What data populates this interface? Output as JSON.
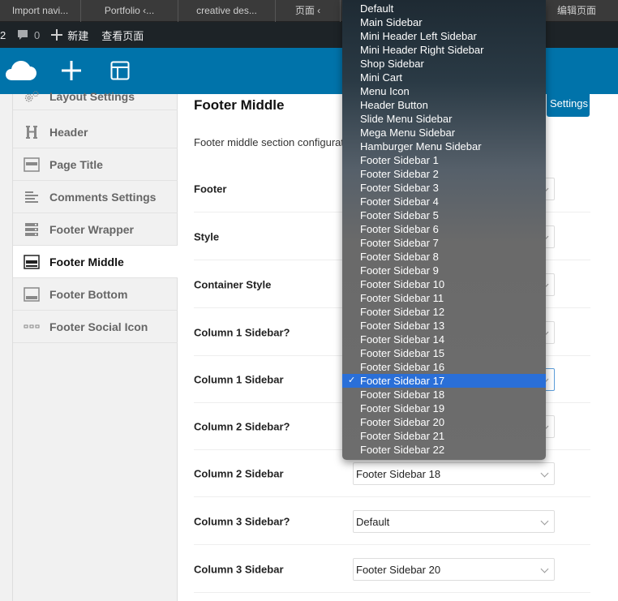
{
  "browser_tabs": [
    "Import navi...",
    "Portfolio ‹...",
    "creative des...",
    "页面 ‹",
    "",
    "",
    "编辑页面"
  ],
  "adminbar": {
    "left_num": "2",
    "comments_count": "0",
    "new_label": "新建",
    "view_label": "查看页面"
  },
  "toolbar": {
    "icons": [
      "cloud-logo-icon",
      "plus-icon",
      "layout-icon"
    ]
  },
  "sidebar": {
    "items": [
      {
        "label": "Layout Settings",
        "icon": "gears-icon"
      },
      {
        "label": "Header",
        "icon": "heading-icon"
      },
      {
        "label": "Page Title",
        "icon": "page-title-icon"
      },
      {
        "label": "Comments Settings",
        "icon": "align-left-icon"
      },
      {
        "label": "Footer Wrapper",
        "icon": "server-icon"
      },
      {
        "label": "Footer Middle",
        "icon": "footer-middle-icon"
      },
      {
        "label": "Footer Bottom",
        "icon": "footer-bottom-icon"
      },
      {
        "label": "Footer Social Icon",
        "icon": "dots-icon"
      }
    ],
    "active_index": 5
  },
  "main": {
    "title": "Footer Middle",
    "save_label": "Settings",
    "description": "Footer middle section configuration",
    "rows": [
      {
        "label": "Footer",
        "value": ""
      },
      {
        "label": "Style",
        "value": ""
      },
      {
        "label": "Container Style",
        "value": ""
      },
      {
        "label": "Column 1 Sidebar?",
        "value": ""
      },
      {
        "label": "Column 1 Sidebar",
        "value": ""
      },
      {
        "label": "Column 2 Sidebar?",
        "value": ""
      },
      {
        "label": "Column 2 Sidebar",
        "value": "Footer Sidebar 18"
      },
      {
        "label": "Column 3 Sidebar?",
        "value": "Default"
      },
      {
        "label": "Column 3 Sidebar",
        "value": "Footer Sidebar 20"
      }
    ]
  },
  "dropdown": {
    "options": [
      "Default",
      "Main Sidebar",
      "Mini Header Left Sidebar",
      "Mini Header Right Sidebar",
      "Shop Sidebar",
      "Mini Cart",
      "Menu Icon",
      "Header Button",
      "Slide Menu Sidebar",
      "Mega Menu Sidebar",
      "Hamburger Menu Sidebar",
      "Footer Sidebar 1",
      "Footer Sidebar 2",
      "Footer Sidebar 3",
      "Footer Sidebar 4",
      "Footer Sidebar 5",
      "Footer Sidebar 6",
      "Footer Sidebar 7",
      "Footer Sidebar 8",
      "Footer Sidebar 9",
      "Footer Sidebar 10",
      "Footer Sidebar 11",
      "Footer Sidebar 12",
      "Footer Sidebar 13",
      "Footer Sidebar 14",
      "Footer Sidebar 15",
      "Footer Sidebar 16",
      "Footer Sidebar 17",
      "Footer Sidebar 18",
      "Footer Sidebar 19",
      "Footer Sidebar 20",
      "Footer Sidebar 21",
      "Footer Sidebar 22"
    ],
    "selected": "Footer Sidebar 17",
    "check_glyph": "✓"
  },
  "colors": {
    "accent": "#0073aa",
    "adminbar": "#1d2327",
    "selected_option": "#2a6fd8"
  }
}
